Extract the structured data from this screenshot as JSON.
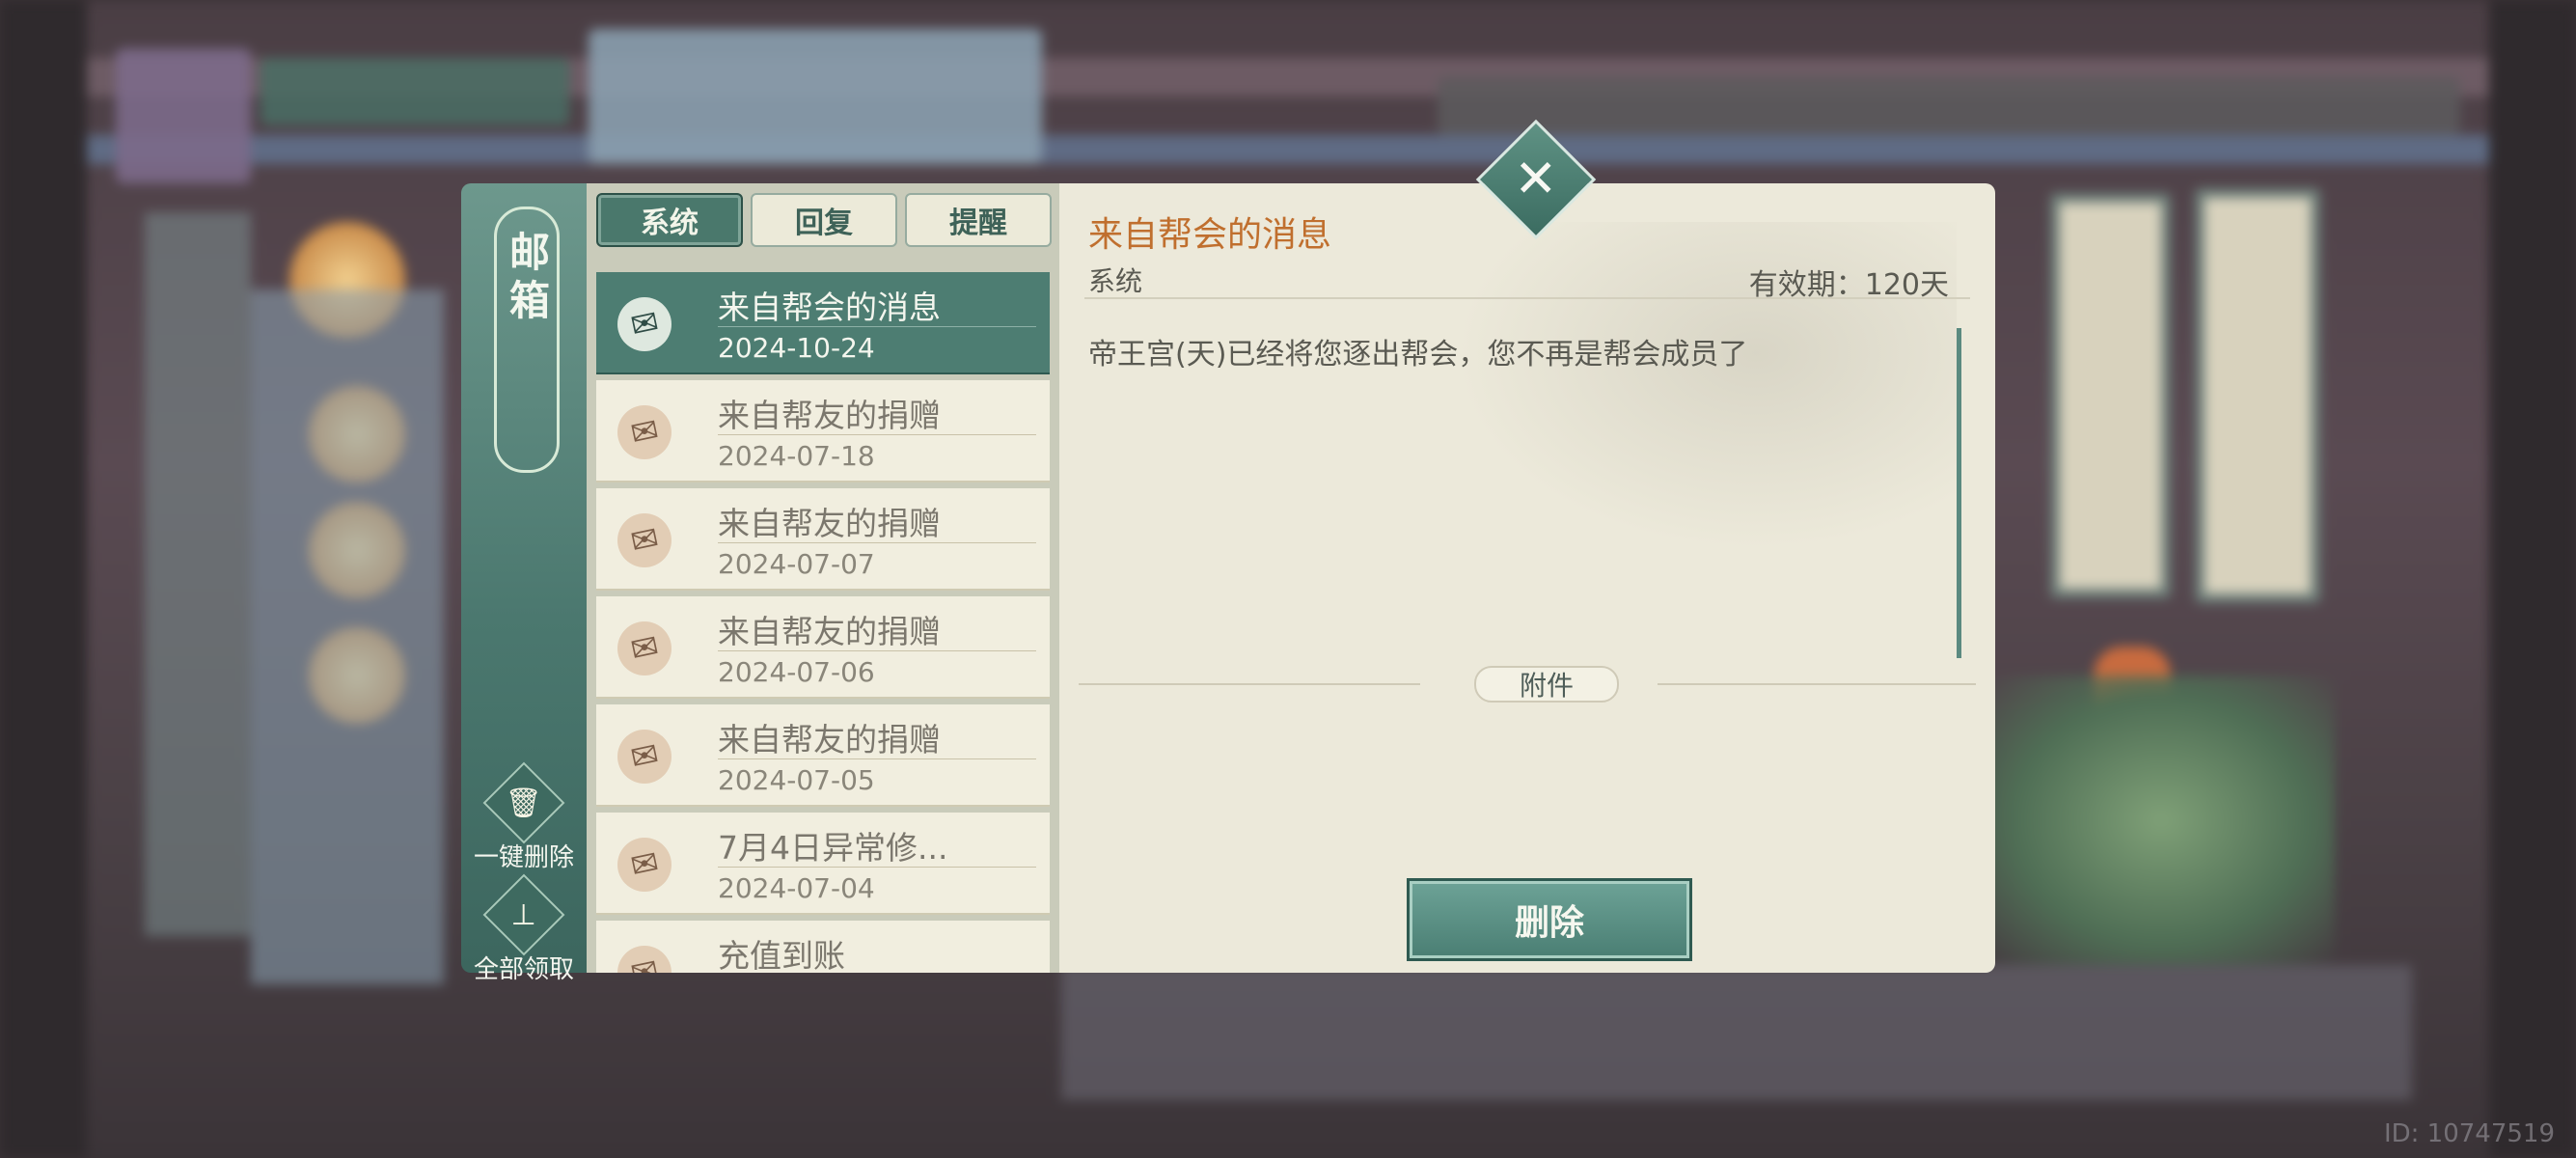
{
  "mailbox": {
    "title": "邮箱",
    "actions": {
      "delete_all": "一键删除",
      "claim_all": "全部领取"
    },
    "tabs": [
      "系统",
      "回复",
      "提醒"
    ],
    "mails": [
      {
        "subject": "来自帮会的消息",
        "date": "2024-10-24"
      },
      {
        "subject": "来自帮友的捐赠",
        "date": "2024-07-18"
      },
      {
        "subject": "来自帮友的捐赠",
        "date": "2024-07-07"
      },
      {
        "subject": "来自帮友的捐赠",
        "date": "2024-07-06"
      },
      {
        "subject": "来自帮友的捐赠",
        "date": "2024-07-05"
      },
      {
        "subject": "7月4日异常修...",
        "date": "2024-07-04"
      },
      {
        "subject": "充值到账",
        "date": ""
      }
    ],
    "detail": {
      "title": "来自帮会的消息",
      "sender": "系统",
      "expiry": "有效期：120天",
      "body": "帝王宫(天)已经将您逐出帮会，您不再是帮会成员了",
      "attachments_label": "附件",
      "delete_button": "删除"
    }
  },
  "footer": {
    "player_id": "ID: 10747519"
  },
  "colors": {
    "accent": "#4a786c",
    "title_orange": "#c06f2e",
    "panel_bg": "#ece9da"
  }
}
